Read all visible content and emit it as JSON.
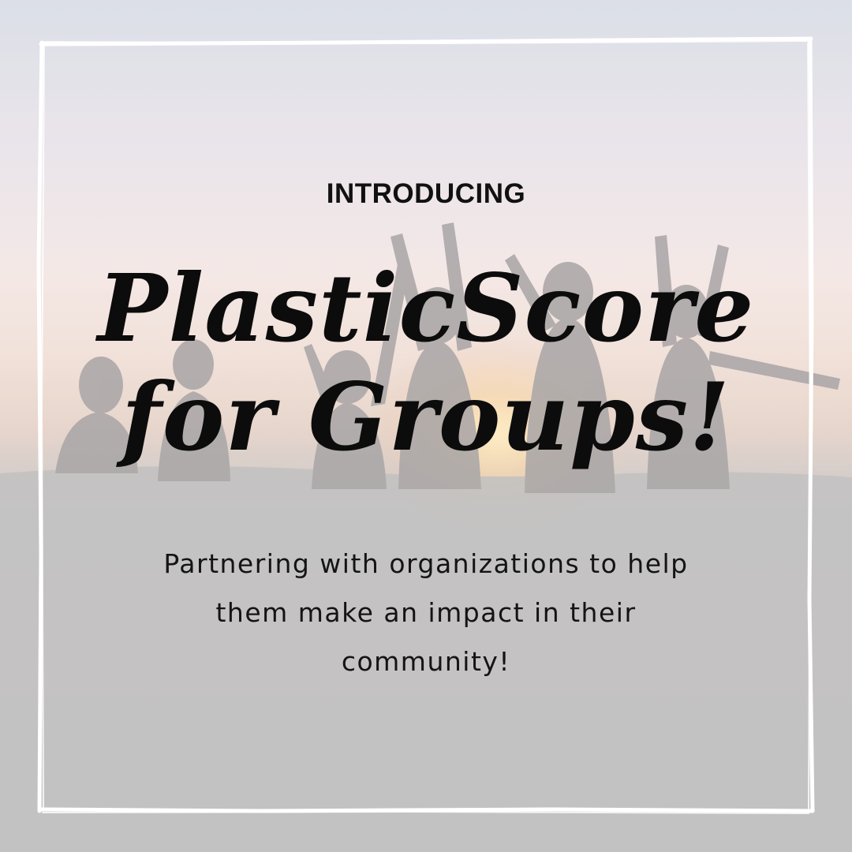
{
  "colors": {
    "text": "#111111",
    "frame": "#ffffff",
    "silhouette": "#9c9899"
  },
  "background": {
    "image": "silhouettes-sunset-icon"
  },
  "post": {
    "kicker": "INTRODUCING",
    "title_lines": [
      "PlasticScore",
      "for Groups!"
    ],
    "description_lines": [
      "Partnering with organizations to help",
      "them make an impact in their",
      "community!"
    ]
  }
}
